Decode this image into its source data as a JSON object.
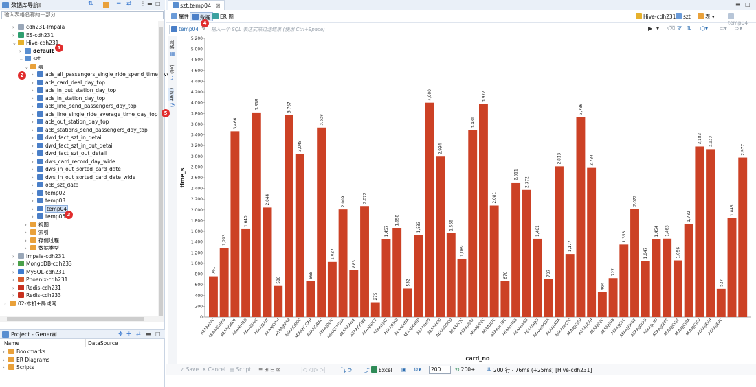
{
  "left_panel": {
    "title": "数据库导航",
    "filter_placeholder": "输入表格名称的一部分",
    "tree": [
      {
        "label": "cdh231-Impala",
        "level": 1,
        "icon": "impala"
      },
      {
        "label": "ES-cdh231",
        "level": 1,
        "icon": "es"
      },
      {
        "label": "Hive-cdh231",
        "level": 1,
        "icon": "hive",
        "expanded": true
      },
      {
        "label": "default",
        "level": 2,
        "icon": "db",
        "bold": true
      },
      {
        "label": "szt",
        "level": 2,
        "icon": "db",
        "expanded": true
      },
      {
        "label": "表",
        "level": 3,
        "icon": "folder",
        "expanded": true
      },
      {
        "label": "ads_all_passengers_single_ride_spend_time_avera",
        "level": 4,
        "icon": "table"
      },
      {
        "label": "ads_card_deal_day_top",
        "level": 4,
        "icon": "table"
      },
      {
        "label": "ads_in_out_station_day_top",
        "level": 4,
        "icon": "table"
      },
      {
        "label": "ads_in_station_day_top",
        "level": 4,
        "icon": "table"
      },
      {
        "label": "ads_line_send_passengers_day_top",
        "level": 4,
        "icon": "table"
      },
      {
        "label": "ads_line_single_ride_average_time_day_top",
        "level": 4,
        "icon": "table"
      },
      {
        "label": "ads_out_station_day_top",
        "level": 4,
        "icon": "table"
      },
      {
        "label": "ads_stations_send_passengers_day_top",
        "level": 4,
        "icon": "table"
      },
      {
        "label": "dwd_fact_szt_in_detail",
        "level": 4,
        "icon": "table"
      },
      {
        "label": "dwd_fact_szt_in_out_detail",
        "level": 4,
        "icon": "table"
      },
      {
        "label": "dwd_fact_szt_out_detail",
        "level": 4,
        "icon": "table"
      },
      {
        "label": "dws_card_record_day_wide",
        "level": 4,
        "icon": "table"
      },
      {
        "label": "dws_in_out_sorted_card_date",
        "level": 4,
        "icon": "table"
      },
      {
        "label": "dws_in_out_sorted_card_date_wide",
        "level": 4,
        "icon": "table"
      },
      {
        "label": "ods_szt_data",
        "level": 4,
        "icon": "table"
      },
      {
        "label": "temp02",
        "level": 4,
        "icon": "table"
      },
      {
        "label": "temp03",
        "level": 4,
        "icon": "table"
      },
      {
        "label": "temp04",
        "level": 4,
        "icon": "table",
        "selected": true
      },
      {
        "label": "temp05",
        "level": 4,
        "icon": "table"
      },
      {
        "label": "视图",
        "level": 3,
        "icon": "folder"
      },
      {
        "label": "索引",
        "level": 3,
        "icon": "folder"
      },
      {
        "label": "存储过程",
        "level": 3,
        "icon": "folder"
      },
      {
        "label": "数据类型",
        "level": 3,
        "icon": "folder"
      },
      {
        "label": "Impala-cdh231",
        "level": 1,
        "icon": "impala"
      },
      {
        "label": "MongoDB-cdh233",
        "level": 1,
        "icon": "mongo"
      },
      {
        "label": "MySQL-cdh231",
        "level": 1,
        "icon": "mysql"
      },
      {
        "label": "Phoenix-cdh231",
        "level": 1,
        "icon": "phoenix"
      },
      {
        "label": "Redis-cdh231",
        "level": 1,
        "icon": "redis"
      },
      {
        "label": "Redis-cdh233",
        "level": 1,
        "icon": "redis"
      },
      {
        "label": "02-本机+局域网",
        "level": 0,
        "icon": "folder"
      }
    ],
    "badges": [
      "1",
      "2",
      "3"
    ]
  },
  "project_panel": {
    "title": "Project - General",
    "col_name": "Name",
    "col_datasource": "DataSource",
    "items": [
      "Bookmarks",
      "ER Diagrams",
      "Scripts"
    ]
  },
  "editor": {
    "tab_title": "szt.temp04",
    "subtabs": [
      "属性",
      "数据",
      "ER 图"
    ],
    "connection": "Hive-cdh231",
    "schema": "szt",
    "object_type": "表",
    "object_name": "temp04",
    "filter_table": "temp04",
    "filter_placeholder": "输入一个 SQL 表达式来过滤结果 (使用 Ctrl+Space)",
    "side_tabs": [
      "网格",
      "文本",
      "Chart"
    ],
    "badges": [
      "4",
      "5"
    ]
  },
  "bottom": {
    "save": "Save",
    "cancel": "Cancel",
    "script": "Script",
    "excel": "Excel",
    "fetch_size": "200",
    "fetch_more": "200+",
    "status": "200 行 - 76ms (+25ms) [Hive-cdh231]"
  },
  "colors": {
    "bar": "#cc4125",
    "badge": "#e12d2d",
    "accent": "#2b6cb0"
  },
  "chart_data": {
    "type": "bar",
    "xlabel": "card_no",
    "ylabel": "time_s",
    "ylim": [
      0,
      5200
    ],
    "yticks": [
      0,
      200,
      400,
      600,
      800,
      1000,
      1200,
      1400,
      1600,
      1800,
      2000,
      2200,
      2400,
      2600,
      2800,
      3000,
      3200,
      3400,
      3600,
      3800,
      4000,
      4200,
      4400,
      4600,
      4800,
      5000,
      5200
    ],
    "categories": [
      "AEAAAHIC",
      "AEAAAGBRG",
      "AEAAJGAQF",
      "AEAAJHIED",
      "AEAAJBAJC",
      "AEAAJBAJT",
      "AEAAJCIAH",
      "AEAAJBFAB",
      "AEAAJDBGC",
      "AEAAJECCAH",
      "AEAAJDBAC",
      "AEAAJDEIC",
      "AEAAJDFGEA",
      "AEAAJDHEE",
      "AEAAJGGBE",
      "AEAAJGICE",
      "AEAAJFJAE",
      "AEAAJFIAB",
      "AEAAJHEIA",
      "AEAAJHHGD",
      "AEAAJHIFF",
      "AEAAJHIIG",
      "AEAAJGDCD",
      "AEAAJICJC",
      "AEAAJIBAF",
      "AEAAJHHJC",
      "AEAAJIEIC",
      "AEAAJHGBC",
      "AEAAJHIGB",
      "AEAAJIAGB",
      "AEAAJIAJCI",
      "AEAAJIBGBA",
      "AEAAJIABA",
      "AEAAJIBCFC",
      "AEAAJJCJEB",
      "AEAAJIEFH",
      "AEAAJIHJC",
      "AEAAJIJGB",
      "AEAAJJCFC",
      "AEAAJJGFGE",
      "AEAAJJGGGI",
      "AEAAJJCIEI",
      "AEAAJJCEFE",
      "AEAAJJCGJE",
      "AEAAJJCIBA",
      "AEAAJJCICE",
      "AEAAJJEEH",
      "AEAAJJEBC"
    ],
    "values": [
      761,
      1293,
      3466,
      1640,
      3818,
      2044,
      580,
      3767,
      3048,
      668,
      3538,
      1027,
      2009,
      883,
      2072,
      275,
      1457,
      1658,
      532,
      1533,
      4000,
      2994,
      1566,
      1089,
      3486,
      3972,
      2081,
      670,
      2511,
      2372,
      1461,
      707,
      2813,
      1177,
      3736,
      2784,
      464,
      727,
      1353,
      2022,
      1047,
      1454,
      1463,
      1056,
      1732,
      3183,
      3133,
      527,
      1845,
      2977
    ],
    "data_labels": [
      "761",
      "1,293",
      "3,466",
      "1,640",
      "3,818",
      "2,044",
      "580",
      "3,767",
      "3,048",
      "668",
      "3,538",
      "1,027",
      "2,009",
      "883",
      "2,072",
      "275",
      "1,457",
      "1,658",
      "532",
      "1,533",
      "4,000",
      "2,994",
      "1,566",
      "1,089",
      "3,486",
      "3,972",
      "2,081",
      "670",
      "2,511",
      "2,372",
      "1,461",
      "707",
      "2,813",
      "1,177",
      "3,736",
      "2,784",
      "464",
      "727",
      "1,353",
      "2,022",
      "1,047",
      "1,454",
      "1,463",
      "1,056",
      "1,732",
      "3,183",
      "3,133",
      "527",
      "1,845",
      "2,977"
    ],
    "grid": false,
    "legend": "none"
  }
}
